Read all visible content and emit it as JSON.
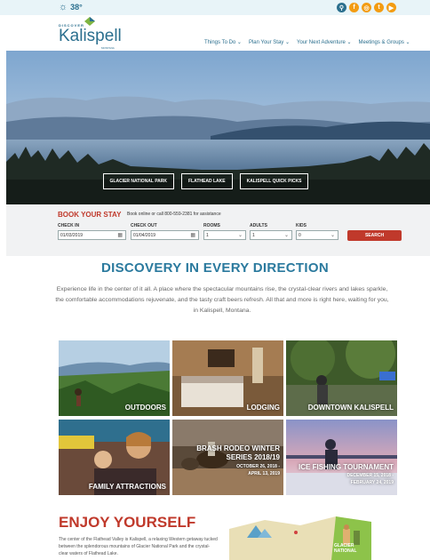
{
  "topbar": {
    "temperature": "38°",
    "socials": [
      {
        "icon": "search-icon",
        "color": "#2b6f8e",
        "glyph": "⚲"
      },
      {
        "icon": "facebook-icon",
        "color": "#f39c12",
        "glyph": "f"
      },
      {
        "icon": "instagram-icon",
        "color": "#f39c12",
        "glyph": "◎"
      },
      {
        "icon": "twitter-icon",
        "color": "#f39c12",
        "glyph": "t"
      },
      {
        "icon": "youtube-icon",
        "color": "#f39c12",
        "glyph": "▶"
      }
    ]
  },
  "logo": {
    "discover": "DISCOVER",
    "name": "Kalispell",
    "tagline": "MONTANA"
  },
  "nav": [
    "Things To Do ⌄",
    "Plan Your Stay ⌄",
    "Your Next Adventure ⌄",
    "Meetings & Groups ⌄"
  ],
  "hero": {
    "buttons": [
      "GLACIER NATIONAL PARK",
      "FLATHEAD LAKE",
      "KALISPELL QUICK PICKS"
    ]
  },
  "booking": {
    "title": "BOOK YOUR STAY",
    "subtitle": "Book online or call 800-559-2381 for assistance",
    "labels": {
      "checkin": "CHECK IN",
      "checkout": "CHECK OUT",
      "rooms": "ROOMS",
      "adults": "ADULTS",
      "kids": "KIDS"
    },
    "values": {
      "checkin": "01/03/2019",
      "checkout": "01/04/2019",
      "rooms": "1",
      "adults": "1",
      "kids": "0"
    },
    "search": "SEARCH"
  },
  "discovery": {
    "title": "DISCOVERY IN EVERY DIRECTION",
    "text": "Experience life in the center of it all. A place where the spectacular mountains rise, the crystal-clear rivers and lakes sparkle, the comfortable accommodations rejuvenate, and the tasty craft beers refresh. All that and more is right here, waiting for you, in Kalispell, Montana."
  },
  "tiles": [
    {
      "label": "OUTDOORS"
    },
    {
      "label": "LODGING"
    },
    {
      "label": "DOWNTOWN KALISPELL"
    },
    {
      "label": "FAMILY ATTRACTIONS"
    },
    {
      "label1": "BRASH RODEO WINTER",
      "label2": "SERIES 2018/19",
      "date1": "OCTOBER 26, 2018 -",
      "date2": "APRIL 13, 2019"
    },
    {
      "label": "ICE FISHING TOURNAMENT",
      "date1": "DECEMBER 15, 2018 -",
      "date2": "FEBRUARY 24, 2019"
    }
  ],
  "enjoy": {
    "title": "ENJOY YOURSELF",
    "text": "The center of the Flathead Valley is Kalispell, a relaxing Western getaway tucked between the splendorous mountains of Glacier National Park and the crystal-clear waters of Flathead Lake."
  },
  "map": {
    "label1": "GLACIER",
    "label2": "NATIONAL"
  }
}
